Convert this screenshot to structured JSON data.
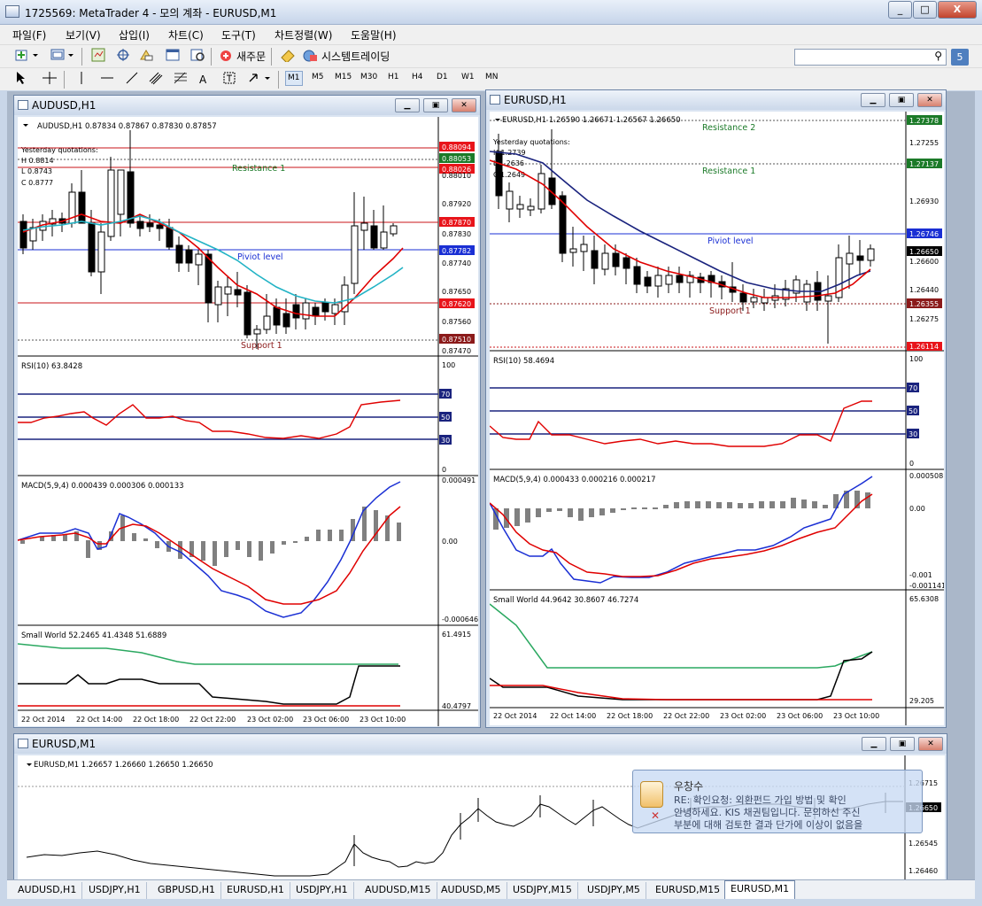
{
  "window": {
    "title": "1725569: MetaTrader 4 - 모의 계좌 - EURUSD,M1",
    "min_label": "_",
    "max_label": "□",
    "close_label": "X"
  },
  "menu": [
    "파일(F)",
    "보기(V)",
    "삽입(I)",
    "차트(C)",
    "도구(T)",
    "차트정렬(W)",
    "도움말(H)"
  ],
  "toolbar": {
    "new_order_label": "새주문",
    "system_trading_label": "시스템트레이딩",
    "text_tool_label": "A",
    "badge": "5"
  },
  "timeframes": [
    "M1",
    "M5",
    "M15",
    "M30",
    "H1",
    "H4",
    "D1",
    "W1",
    "MN"
  ],
  "active_timeframe": "M1",
  "charts": {
    "audusd": {
      "title": "AUDUSD,H1",
      "ohlc": "AUDUSD,H1  0.87834 0.87867 0.87830 0.87857",
      "yesterday": [
        "Yesterday quotations:",
        "H 0.8814",
        "L 0.8743",
        "C 0.8777"
      ],
      "resistance_label": "Resistance 1",
      "pivot_label": "Piviot level",
      "support_label": "Support 1",
      "price_ticks": [
        "0.88010",
        "0.87920",
        "0.87830",
        "0.87740",
        "0.87650",
        "0.87560",
        "0.87470"
      ],
      "level_tags": [
        {
          "text": "0.88094",
          "color": "#e8141a"
        },
        {
          "text": "0.88053",
          "color": "#1b7a28"
        },
        {
          "text": "0.88026",
          "color": "#e8141a"
        },
        {
          "text": "0.87870",
          "color": "#e8141a"
        },
        {
          "text": "0.87782",
          "color": "#1a2fd4"
        },
        {
          "text": "0.87620",
          "color": "#e8141a"
        },
        {
          "text": "0.87510",
          "color": "#8b1a1a"
        }
      ],
      "rsi_label": "RSI(10) 63.8428",
      "rsi_scale": [
        "100",
        "70",
        "50",
        "30",
        "0"
      ],
      "macd_label": "MACD(5,9,4) 0.000439 0.000306 0.000133",
      "macd_scale": [
        "0.000491",
        "0.00",
        "-0.000646"
      ],
      "sw_label": "Small World 52.2465 41.4348 51.6889",
      "sw_scale": [
        "61.4915",
        "40.4797"
      ],
      "time_axis": [
        "22 Oct 2014",
        "22 Oct 14:00",
        "22 Oct 18:00",
        "22 Oct 22:00",
        "23 Oct 02:00",
        "23 Oct 06:00",
        "23 Oct 10:00"
      ]
    },
    "eurusd_h1": {
      "title": "EURUSD,H1",
      "ohlc": "EURUSD,H1  1.26590 1.26671 1.26567 1.26650",
      "yesterday": [
        "Yesterday quotations:",
        "H 1.2739",
        "L 1.2636",
        "C 1.2649"
      ],
      "resistance2_label": "Resistance 2",
      "resistance_label": "Resistance 1",
      "pivot_label": "Piviot level",
      "support_label": "Support 1",
      "price_ticks": [
        "1.27255",
        "1.26930",
        "1.26600",
        "1.26440",
        "1.26275"
      ],
      "level_tags": [
        {
          "text": "1.27378",
          "color": "#1b7a28"
        },
        {
          "text": "1.27137",
          "color": "#1b7a28"
        },
        {
          "text": "1.26746",
          "color": "#1a2fd4"
        },
        {
          "text": "1.26650",
          "color": "#000000"
        },
        {
          "text": "1.26355",
          "color": "#8b1a1a"
        },
        {
          "text": "1.26114",
          "color": "#e8141a"
        }
      ],
      "rsi_label": "RSI(10) 58.4694",
      "rsi_scale": [
        "100",
        "70",
        "50",
        "30",
        "0"
      ],
      "macd_label": "MACD(5,9,4) 0.000433 0.000216 0.000217",
      "macd_scale": [
        "0.000508",
        "0.00",
        "-0.001",
        "-0.001141"
      ],
      "sw_label": "Small World 44.9642 30.8607 46.7274",
      "sw_scale": [
        "65.6308",
        "29.205"
      ],
      "time_axis": [
        "22 Oct 2014",
        "22 Oct 14:00",
        "22 Oct 18:00",
        "22 Oct 22:00",
        "23 Oct 02:00",
        "23 Oct 06:00",
        "23 Oct 10:00"
      ]
    },
    "eurusd_m1": {
      "title": "EURUSD,M1",
      "ohlc": "EURUSD,M1  1.26657 1.26660 1.26650 1.26650",
      "price_ticks": [
        "1.26715",
        "1.26545",
        "1.26460"
      ],
      "last_tag": "1.26650"
    }
  },
  "notification": {
    "sender": "우창수",
    "subject": "RE: 확인요청: 외환펀드 가입 방법 및 확인",
    "body1": "안녕하세요. KIS 채권팀입니다. 문의하신 주신",
    "body2": "부분에 대해 검토한 결과 단가에 이상이 없음을"
  },
  "tabs": [
    "AUDUSD,H1",
    "USDJPY,H1",
    "GBPUSD,H1",
    "EURUSD,H1",
    "USDJPY,H1",
    "AUDUSD,M15",
    "AUDUSD,M5",
    "USDJPY,M15",
    "USDJPY,M5",
    "EURUSD,M15",
    "EURUSD,M1"
  ],
  "active_tab": "EURUSD,M1",
  "colors": {
    "pivot": "#1a2fd4",
    "support_resistance": "#c8141a",
    "ma_fast": "#e00000",
    "ma_slow": "#1a237e",
    "ma_cyan": "#22b3c5",
    "sw_green": "#2aa860"
  }
}
